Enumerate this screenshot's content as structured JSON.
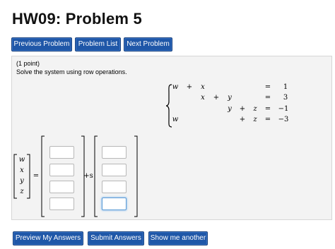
{
  "page": {
    "title": "HW09: Problem 5"
  },
  "nav": {
    "previous_label": "Previous Problem",
    "list_label": "Problem List",
    "next_label": "Next Problem"
  },
  "problem": {
    "points": "(1 point)",
    "instruction": "Solve the system using row operations."
  },
  "system": {
    "rows": [
      {
        "terms": [
          "w",
          "+",
          "x",
          "",
          "",
          "",
          ""
        ],
        "eq": "=",
        "rhs": "1"
      },
      {
        "terms": [
          "",
          "",
          "x",
          "+",
          "y",
          "",
          ""
        ],
        "eq": "=",
        "rhs": "3"
      },
      {
        "terms": [
          "",
          "",
          "",
          "",
          "y",
          "+",
          "z"
        ],
        "eq": "=",
        "rhs": "−1"
      },
      {
        "terms": [
          "w",
          "",
          "",
          "",
          "",
          "+",
          "z"
        ],
        "eq": "=",
        "rhs": "−3"
      }
    ]
  },
  "solution": {
    "vector": [
      "w",
      "x",
      "y",
      "z"
    ],
    "equals": "=",
    "plus_s": "+s",
    "particular_values": [
      "",
      "",
      "",
      ""
    ],
    "direction_values": [
      "",
      "",
      "",
      ""
    ]
  },
  "actions": {
    "preview_label": "Preview My Answers",
    "submit_label": "Submit Answers",
    "show_label": "Show me another"
  }
}
